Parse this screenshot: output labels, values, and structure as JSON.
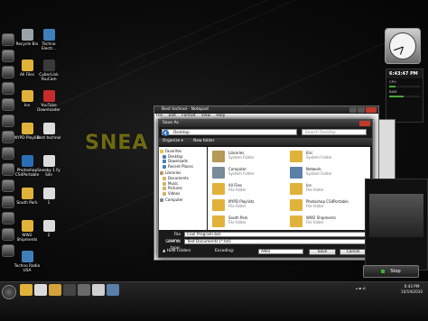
{
  "desktop": {
    "wallpaper_text": "SNEA",
    "icons": [
      {
        "label": "Recycle Bin",
        "color": "#9aa3a8"
      },
      {
        "label": "Techno Electr...",
        "color": "#3f7fb9"
      },
      {
        "label": "All Files",
        "color": "#e0b23a"
      },
      {
        "label": "CyberLink YouCam",
        "color": "#3a3a3a"
      },
      {
        "label": "Ice",
        "color": "#e0b23a"
      },
      {
        "label": "YouTube Downloader",
        "color": "#c72b2b"
      },
      {
        "label": "NYPD Playlist",
        "color": "#e0b23a"
      },
      {
        "label": "Best technol",
        "color": "#dcdcdc"
      },
      {
        "label": "Photoshop CS4Portable",
        "color": "#2a6fb6"
      },
      {
        "label": "Sneaky 1 Fy Sile",
        "color": "#dcdcdc"
      },
      {
        "label": "South Park",
        "color": "#e0b23a"
      },
      {
        "label": "1",
        "color": "#dcdcdc"
      },
      {
        "label": "WW2 Shipments",
        "color": "#e0b23a"
      },
      {
        "label": "2",
        "color": "#dcdcdc"
      },
      {
        "label": "Techno Radio USA",
        "color": "#3f7fb9"
      }
    ]
  },
  "gadget": {
    "time": "6:43:47 PM",
    "cpu_label": "CPU",
    "cpu_value": 22,
    "ram_label": "RAM",
    "ram_value": 48
  },
  "notepad": {
    "title": "Best technol - Notepad",
    "menu": [
      "File",
      "Edit",
      "Format",
      "View",
      "Help"
    ]
  },
  "dialog": {
    "title": "Save As",
    "address": "Desktop",
    "search_placeholder": "Search Desktop",
    "organize": "Organize ▾",
    "new_folder": "New folder",
    "nav": {
      "favorites_label": "Favorites",
      "favorites": [
        "Desktop",
        "Downloads",
        "Recent Places"
      ],
      "libraries_label": "Libraries",
      "libraries": [
        "Documents",
        "Music",
        "Pictures",
        "Videos"
      ],
      "computer_label": "Computer"
    },
    "files": [
      {
        "name": "Libraries",
        "type": "System Folder",
        "color": "#b59a55"
      },
      {
        "name": "Eric",
        "type": "System Folder",
        "color": "#e0b23a"
      },
      {
        "name": "Computer",
        "type": "System Folder",
        "color": "#7a8a99"
      },
      {
        "name": "Network",
        "type": "System Folder",
        "color": "#5c7fa8"
      },
      {
        "name": "All Files",
        "type": "File folder",
        "color": "#e0b23a"
      },
      {
        "name": "Ice",
        "type": "File folder",
        "color": "#e0b23a"
      },
      {
        "name": "NYPD Playlists",
        "type": "File folder",
        "color": "#e0b23a"
      },
      {
        "name": "Photoshop CS4Portable",
        "type": "File folder",
        "color": "#e0b23a"
      },
      {
        "name": "South Park",
        "type": "File folder",
        "color": "#e0b23a"
      },
      {
        "name": "WW2 Shipments",
        "type": "File folder",
        "color": "#e0b23a"
      }
    ],
    "filename_label": "File name:",
    "filename_value": "Cool Program.bat",
    "savetype_label": "Save as type:",
    "savetype_value": "Text Documents (*.txt)",
    "hide_folders": "▲ Hide Folders",
    "encoding_label": "Encoding:",
    "encoding_value": "ANSI",
    "save_button": "Save",
    "cancel_button": "Cancel"
  },
  "media": {
    "stop_label": "Stop"
  },
  "taskbar": {
    "time": "6:43 PM",
    "date": "10/19/2010",
    "pinned": [
      {
        "name": "explorer",
        "color": "#e0b23a"
      },
      {
        "name": "media",
        "color": "#dcdcdc"
      },
      {
        "name": "tools",
        "color": "#d4a23a"
      },
      {
        "name": "webcam",
        "color": "#444444"
      },
      {
        "name": "media2",
        "color": "#6a6a6a"
      },
      {
        "name": "notepad",
        "color": "#cfcfcf"
      },
      {
        "name": "computer",
        "color": "#5a7fa8"
      }
    ]
  }
}
